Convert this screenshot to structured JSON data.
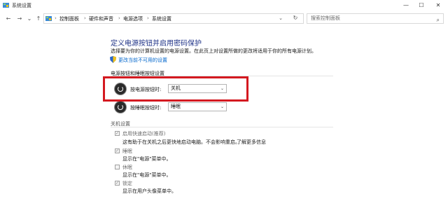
{
  "window": {
    "title": "系统设置",
    "controls": [
      "—",
      "☐",
      "✕"
    ]
  },
  "nav": {
    "back": "←",
    "forward": "→",
    "recent": "⌄",
    "up": "↑",
    "breadcrumbs": [
      "控制面板",
      "硬件和声音",
      "电源选项",
      "系统设置"
    ],
    "separator": "›",
    "refresh": "↻",
    "dropdown": "⌄",
    "search_placeholder": "搜索控制面板"
  },
  "page": {
    "heading": "定义电源按钮并启用密码保护",
    "description": "选择要为你的计算机设置的电源设置。在此页上对设置所做的更改将适用于你的所有电源计划。",
    "change_link": "更改当前不可用的设置"
  },
  "power_buttons": {
    "section_title": "电源按钮和睡眠按钮设置",
    "power_label": "按电源按钮时:",
    "power_value": "关机",
    "sleep_label": "按睡眠按钮时:",
    "sleep_value": "睡眠"
  },
  "shutdown": {
    "section_title": "关机设置",
    "options": [
      {
        "label": "启用快速启动(推荐)",
        "desc": "这有助于在关机之后更快地启动电脑。不会影响重启。",
        "link": "了解更多信息",
        "checked": true
      },
      {
        "label": "睡眠",
        "desc": "显示在\"电源\"菜单中。",
        "checked": true
      },
      {
        "label": "休眠",
        "desc": "显示在\"电源\"菜单中。",
        "checked": false
      },
      {
        "label": "锁定",
        "desc": "显示在用户头像菜单中。",
        "checked": true
      }
    ]
  },
  "colors": {
    "highlight": "#d41920",
    "heading": "#1e3287",
    "link": "#0066cc"
  }
}
